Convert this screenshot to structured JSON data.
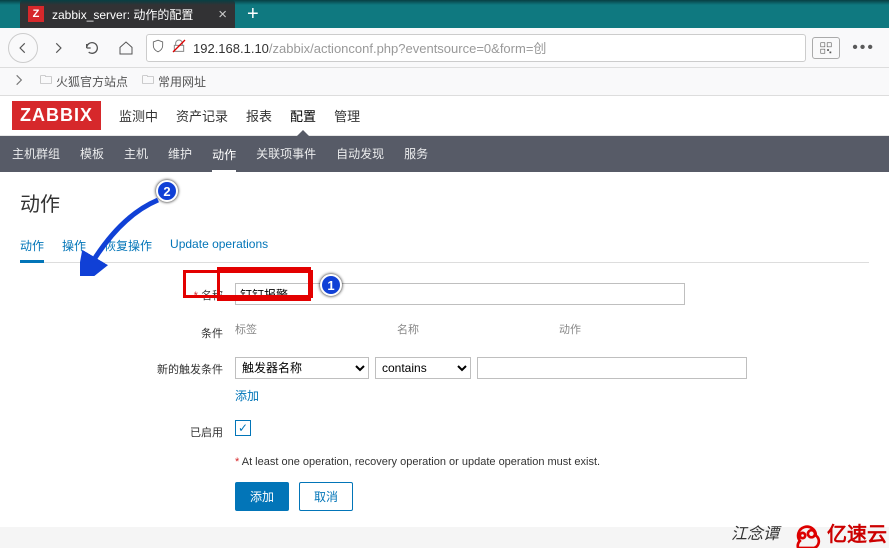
{
  "browser": {
    "tab_title": "zabbix_server: 动作的配置",
    "tab_icon_letter": "Z",
    "url_display_black": "192.168.1.10",
    "url_display_gray": "/zabbix/actionconf.php?eventsource=0&form=创",
    "bookmarks": [
      "火狐官方站点",
      "常用网址"
    ]
  },
  "zabbix": {
    "logo": "ZABBIX",
    "top_menu": [
      "监测中",
      "资产记录",
      "报表",
      "配置",
      "管理"
    ],
    "top_menu_active": "配置",
    "sub_menu": [
      "主机群组",
      "模板",
      "主机",
      "维护",
      "动作",
      "关联项事件",
      "自动发现",
      "服务"
    ],
    "sub_menu_active": "动作",
    "page_title": "动作",
    "form_tabs": [
      "动作",
      "操作",
      "恢复操作",
      "Update operations"
    ],
    "form_tab_active": "动作",
    "labels": {
      "name": "名称",
      "conditions": "条件",
      "new_cond": "新的触发条件",
      "enabled": "已启用"
    },
    "name_value": "钉钉报警",
    "cond_headers": {
      "label": "标签",
      "name": "名称",
      "action": "动作"
    },
    "new_cond": {
      "sel1": "触发器名称",
      "sel2": "contains",
      "add_link": "添加"
    },
    "warning": "At least one operation, recovery operation or update operation must exist.",
    "buttons": {
      "add": "添加",
      "cancel": "取消"
    }
  },
  "annotations": {
    "marker1": "1",
    "marker2": "2"
  },
  "watermark": {
    "text1": "江念谭",
    "text2": "亿速云"
  }
}
